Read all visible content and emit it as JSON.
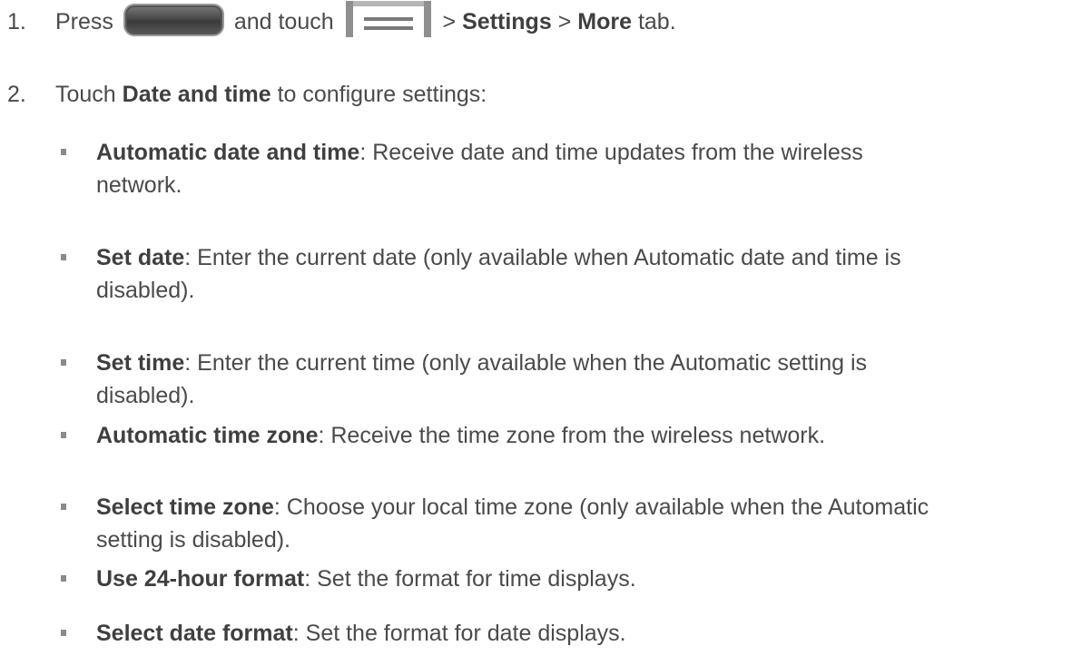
{
  "steps": [
    {
      "number": "1.",
      "press": "Press",
      "and_touch": "and touch",
      "sep1": ">",
      "settings": "Settings",
      "sep2": ">",
      "more": "More",
      "tab": "tab."
    },
    {
      "number": "2.",
      "touch": "Touch",
      "date_and_time": "Date and time",
      "rest": "to configure settings:"
    }
  ],
  "icons": {
    "home_key": "home-key-icon",
    "menu_key": "menu-key-icon"
  },
  "bullets": [
    {
      "term": "Automatic date and time",
      "line1": ": Receive date and time updates from the wireless",
      "line2": "network."
    },
    {
      "term": "Set date",
      "line1": ": Enter the current date (only available when Automatic date and time is",
      "line2": "disabled)."
    },
    {
      "term": "Set time",
      "line1": ": Enter the current time (only available when the Automatic setting is",
      "line2": "disabled)."
    },
    {
      "term": "Automatic time zone",
      "line1": ": Receive the time zone from the wireless network.",
      "line2": ""
    },
    {
      "term": "Select time zone",
      "line1": ": Choose your local time zone (only available when the Automatic",
      "line2": "setting is disabled)."
    },
    {
      "term": "Use 24-hour format",
      "line1": ": Set the format for time displays.",
      "line2": ""
    },
    {
      "term": "Select date format",
      "line1": ": Set the format for date displays.",
      "line2": ""
    }
  ]
}
